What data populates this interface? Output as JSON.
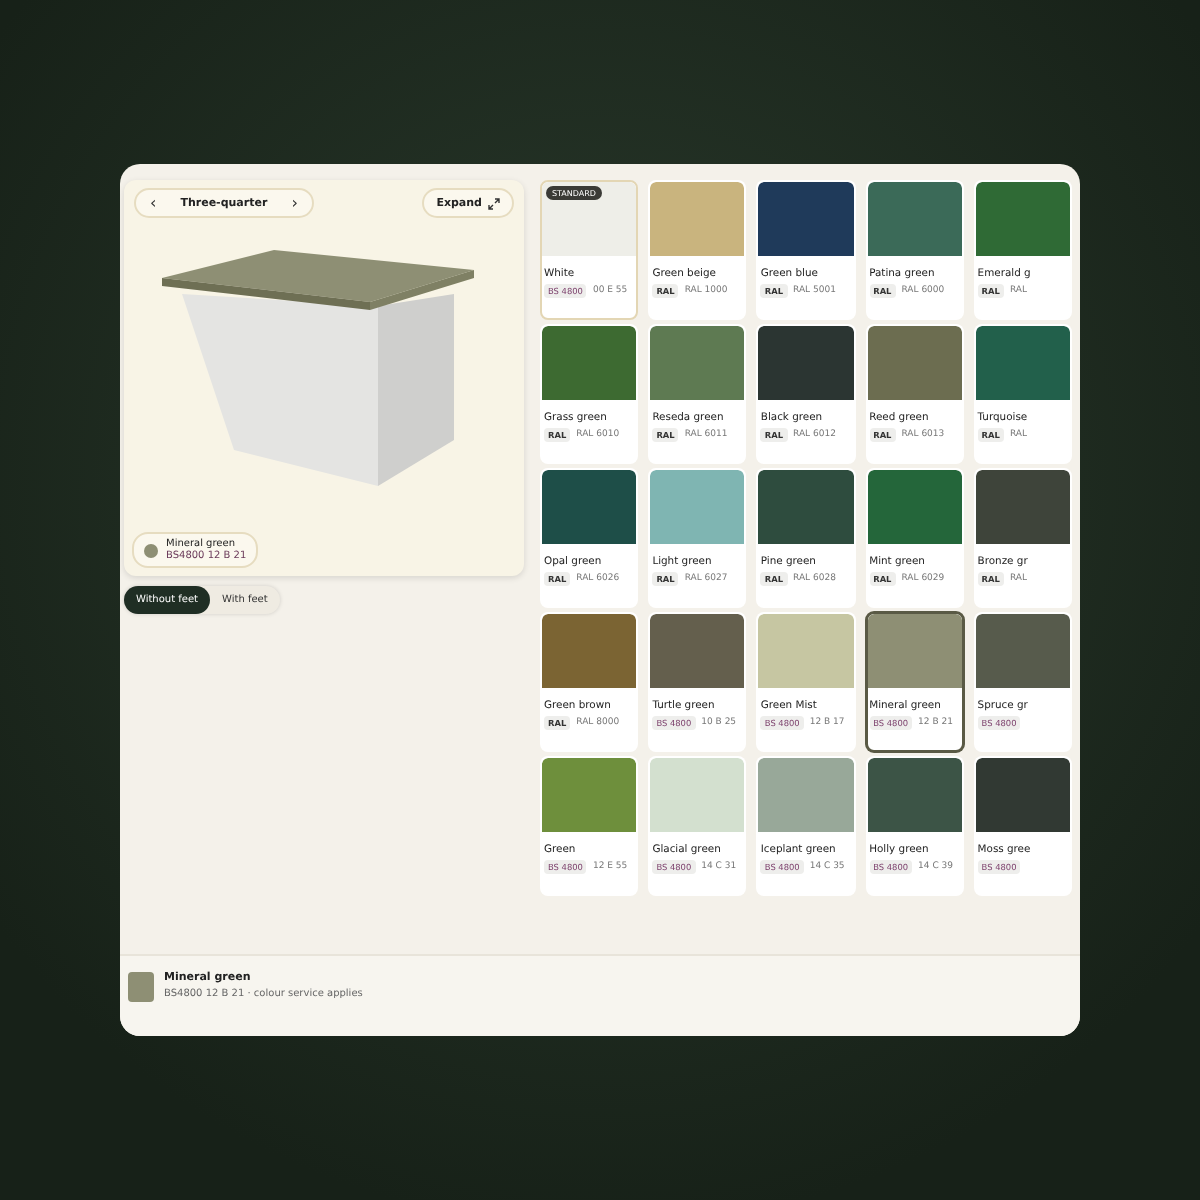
{
  "viewer": {
    "view_label": "Three-quarter",
    "prev": "‹",
    "next": "›",
    "expand": "Expand",
    "chip": {
      "name": "Mineral green",
      "code": "BS4800 12 B 21",
      "color": "#8e8f74"
    }
  },
  "feet_toggle": [
    {
      "label": "Without feet",
      "selected": true
    },
    {
      "label": "With feet",
      "selected": false
    }
  ],
  "swatches": [
    {
      "name": "White",
      "system": "BS 4800",
      "code": "00 E 55",
      "color": "#eeeee8",
      "badge": "STANDARD",
      "selected": false
    },
    {
      "name": "Green beige",
      "system": "RAL",
      "code": "RAL 1000",
      "color": "#c9b47e",
      "selected": false
    },
    {
      "name": "Green blue",
      "system": "RAL",
      "code": "RAL 5001",
      "color": "#1f3a5a",
      "selected": false
    },
    {
      "name": "Patina green",
      "system": "RAL",
      "code": "RAL 6000",
      "color": "#3b6a58",
      "selected": false
    },
    {
      "name": "Emerald g",
      "system": "RAL",
      "code": "RAL",
      "color": "#2f6a35",
      "selected": false
    },
    {
      "name": "Grass green",
      "system": "RAL",
      "code": "RAL 6010",
      "color": "#3d6a31",
      "selected": false
    },
    {
      "name": "Reseda green",
      "system": "RAL",
      "code": "RAL 6011",
      "color": "#5e7a52",
      "selected": false
    },
    {
      "name": "Black green",
      "system": "RAL",
      "code": "RAL 6012",
      "color": "#2b3532",
      "selected": false
    },
    {
      "name": "Reed green",
      "system": "RAL",
      "code": "RAL 6013",
      "color": "#6c6d50",
      "selected": false
    },
    {
      "name": "Turquoise",
      "system": "RAL",
      "code": "RAL",
      "color": "#22604b",
      "selected": false
    },
    {
      "name": "Opal green",
      "system": "RAL",
      "code": "RAL 6026",
      "color": "#1e4e48",
      "selected": false
    },
    {
      "name": "Light green",
      "system": "RAL",
      "code": "RAL 6027",
      "color": "#7fb5b2",
      "selected": false
    },
    {
      "name": "Pine green",
      "system": "RAL",
      "code": "RAL 6028",
      "color": "#2e4c3e",
      "selected": false
    },
    {
      "name": "Mint green",
      "system": "RAL",
      "code": "RAL 6029",
      "color": "#24663a",
      "selected": false
    },
    {
      "name": "Bronze gr",
      "system": "RAL",
      "code": "RAL",
      "color": "#3e443a",
      "selected": false
    },
    {
      "name": "Green brown",
      "system": "RAL",
      "code": "RAL 8000",
      "color": "#7b6433",
      "selected": false
    },
    {
      "name": "Turtle green",
      "system": "BS 4800",
      "code": "10 B 25",
      "color": "#645f4d",
      "selected": false
    },
    {
      "name": "Green Mist",
      "system": "BS 4800",
      "code": "12 B 17",
      "color": "#c6c6a2",
      "selected": false
    },
    {
      "name": "Mineral green",
      "system": "BS 4800",
      "code": "12 B 21",
      "color": "#8e8f74",
      "selected": true
    },
    {
      "name": "Spruce gr",
      "system": "BS 4800",
      "color": "#575b4c",
      "selected": false
    },
    {
      "name": "Green",
      "system": "BS 4800",
      "code": "12 E 55",
      "color": "#6e8f3c",
      "selected": false
    },
    {
      "name": "Glacial green",
      "system": "BS 4800",
      "code": "14 C 31",
      "color": "#d3e0cf",
      "selected": false
    },
    {
      "name": "Iceplant green",
      "system": "BS 4800",
      "code": "14 C 35",
      "color": "#98a899",
      "selected": false
    },
    {
      "name": "Holly green",
      "system": "BS 4800",
      "code": "14 C 39",
      "color": "#3c5446",
      "selected": false
    },
    {
      "name": "Moss gree",
      "system": "BS 4800",
      "color": "#313933",
      "selected": false
    }
  ],
  "summary": {
    "name": "Mineral green",
    "detail": "BS4800 12 B 21 · colour service applies",
    "color": "#8e8f74"
  }
}
